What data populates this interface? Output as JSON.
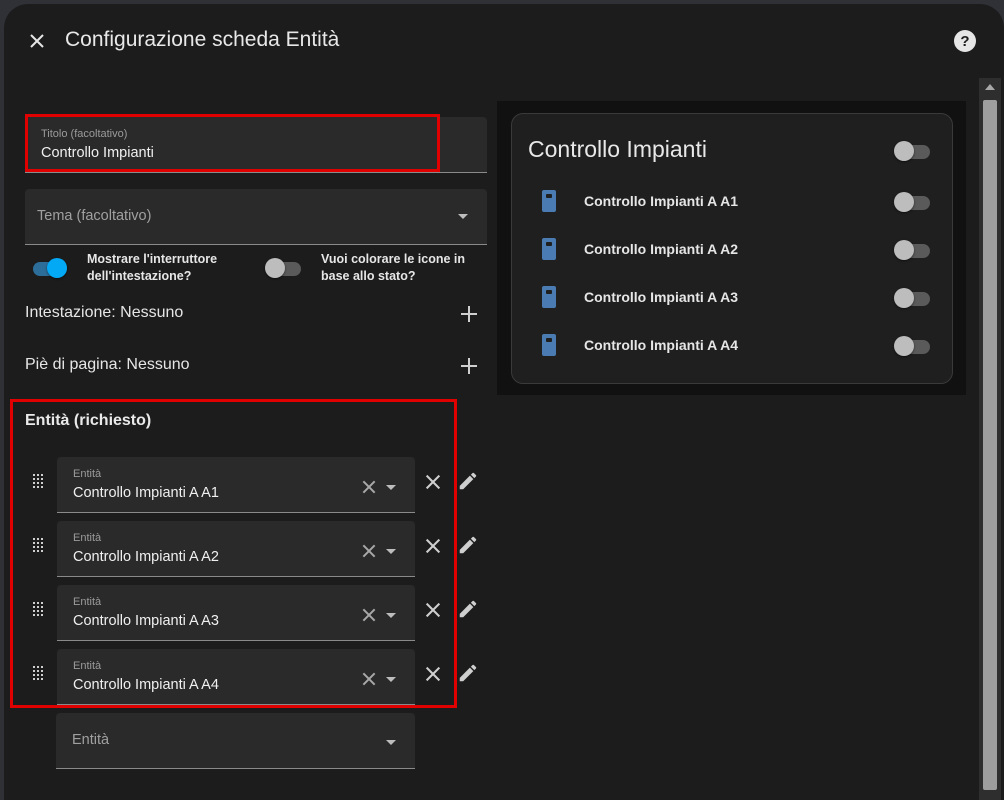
{
  "dialog": {
    "title": "Configurazione scheda Entità",
    "help_glyph": "?"
  },
  "form": {
    "title_field": {
      "label": "Titolo (facoltativo)",
      "value": "Controllo Impianti"
    },
    "theme_field": {
      "placeholder": "Tema (facoltativo)"
    },
    "toggles": [
      {
        "label": "Mostrare l'interruttore dell'intestazione?",
        "on": true
      },
      {
        "label": "Vuoi colorare le icone in base allo stato?",
        "on": false
      }
    ],
    "header_row": "Intestazione: Nessuno",
    "footer_row": "Piè di pagina: Nessuno",
    "entities_heading": "Entità (richiesto)",
    "entities": [
      {
        "label": "Entità",
        "value": "Controllo Impianti A A1"
      },
      {
        "label": "Entità",
        "value": "Controllo Impianti A A2"
      },
      {
        "label": "Entità",
        "value": "Controllo Impianti A A3"
      },
      {
        "label": "Entità",
        "value": "Controllo Impianti A A4"
      }
    ],
    "new_entity_placeholder": "Entità"
  },
  "preview": {
    "card_title": "Controllo Impianti",
    "header_toggle_on": false,
    "rows": [
      {
        "name": "Controllo Impianti A A1",
        "on": false
      },
      {
        "name": "Controllo Impianti A A2",
        "on": false
      },
      {
        "name": "Controllo Impianti A A3",
        "on": false
      },
      {
        "name": "Controllo Impianti A A4",
        "on": false
      }
    ]
  },
  "colors": {
    "accent": "#03a9f4",
    "highlight": "#e00000",
    "entity_icon": "#4a7bb3"
  },
  "icons": {
    "close": "close-icon",
    "help": "help-circle-icon",
    "add": "plus-icon",
    "drag": "drag-handle-icon",
    "clear": "clear-icon",
    "dropdown": "chevron-down-icon",
    "remove": "remove-icon",
    "edit": "pencil-icon",
    "entity": "switch-device-icon"
  }
}
